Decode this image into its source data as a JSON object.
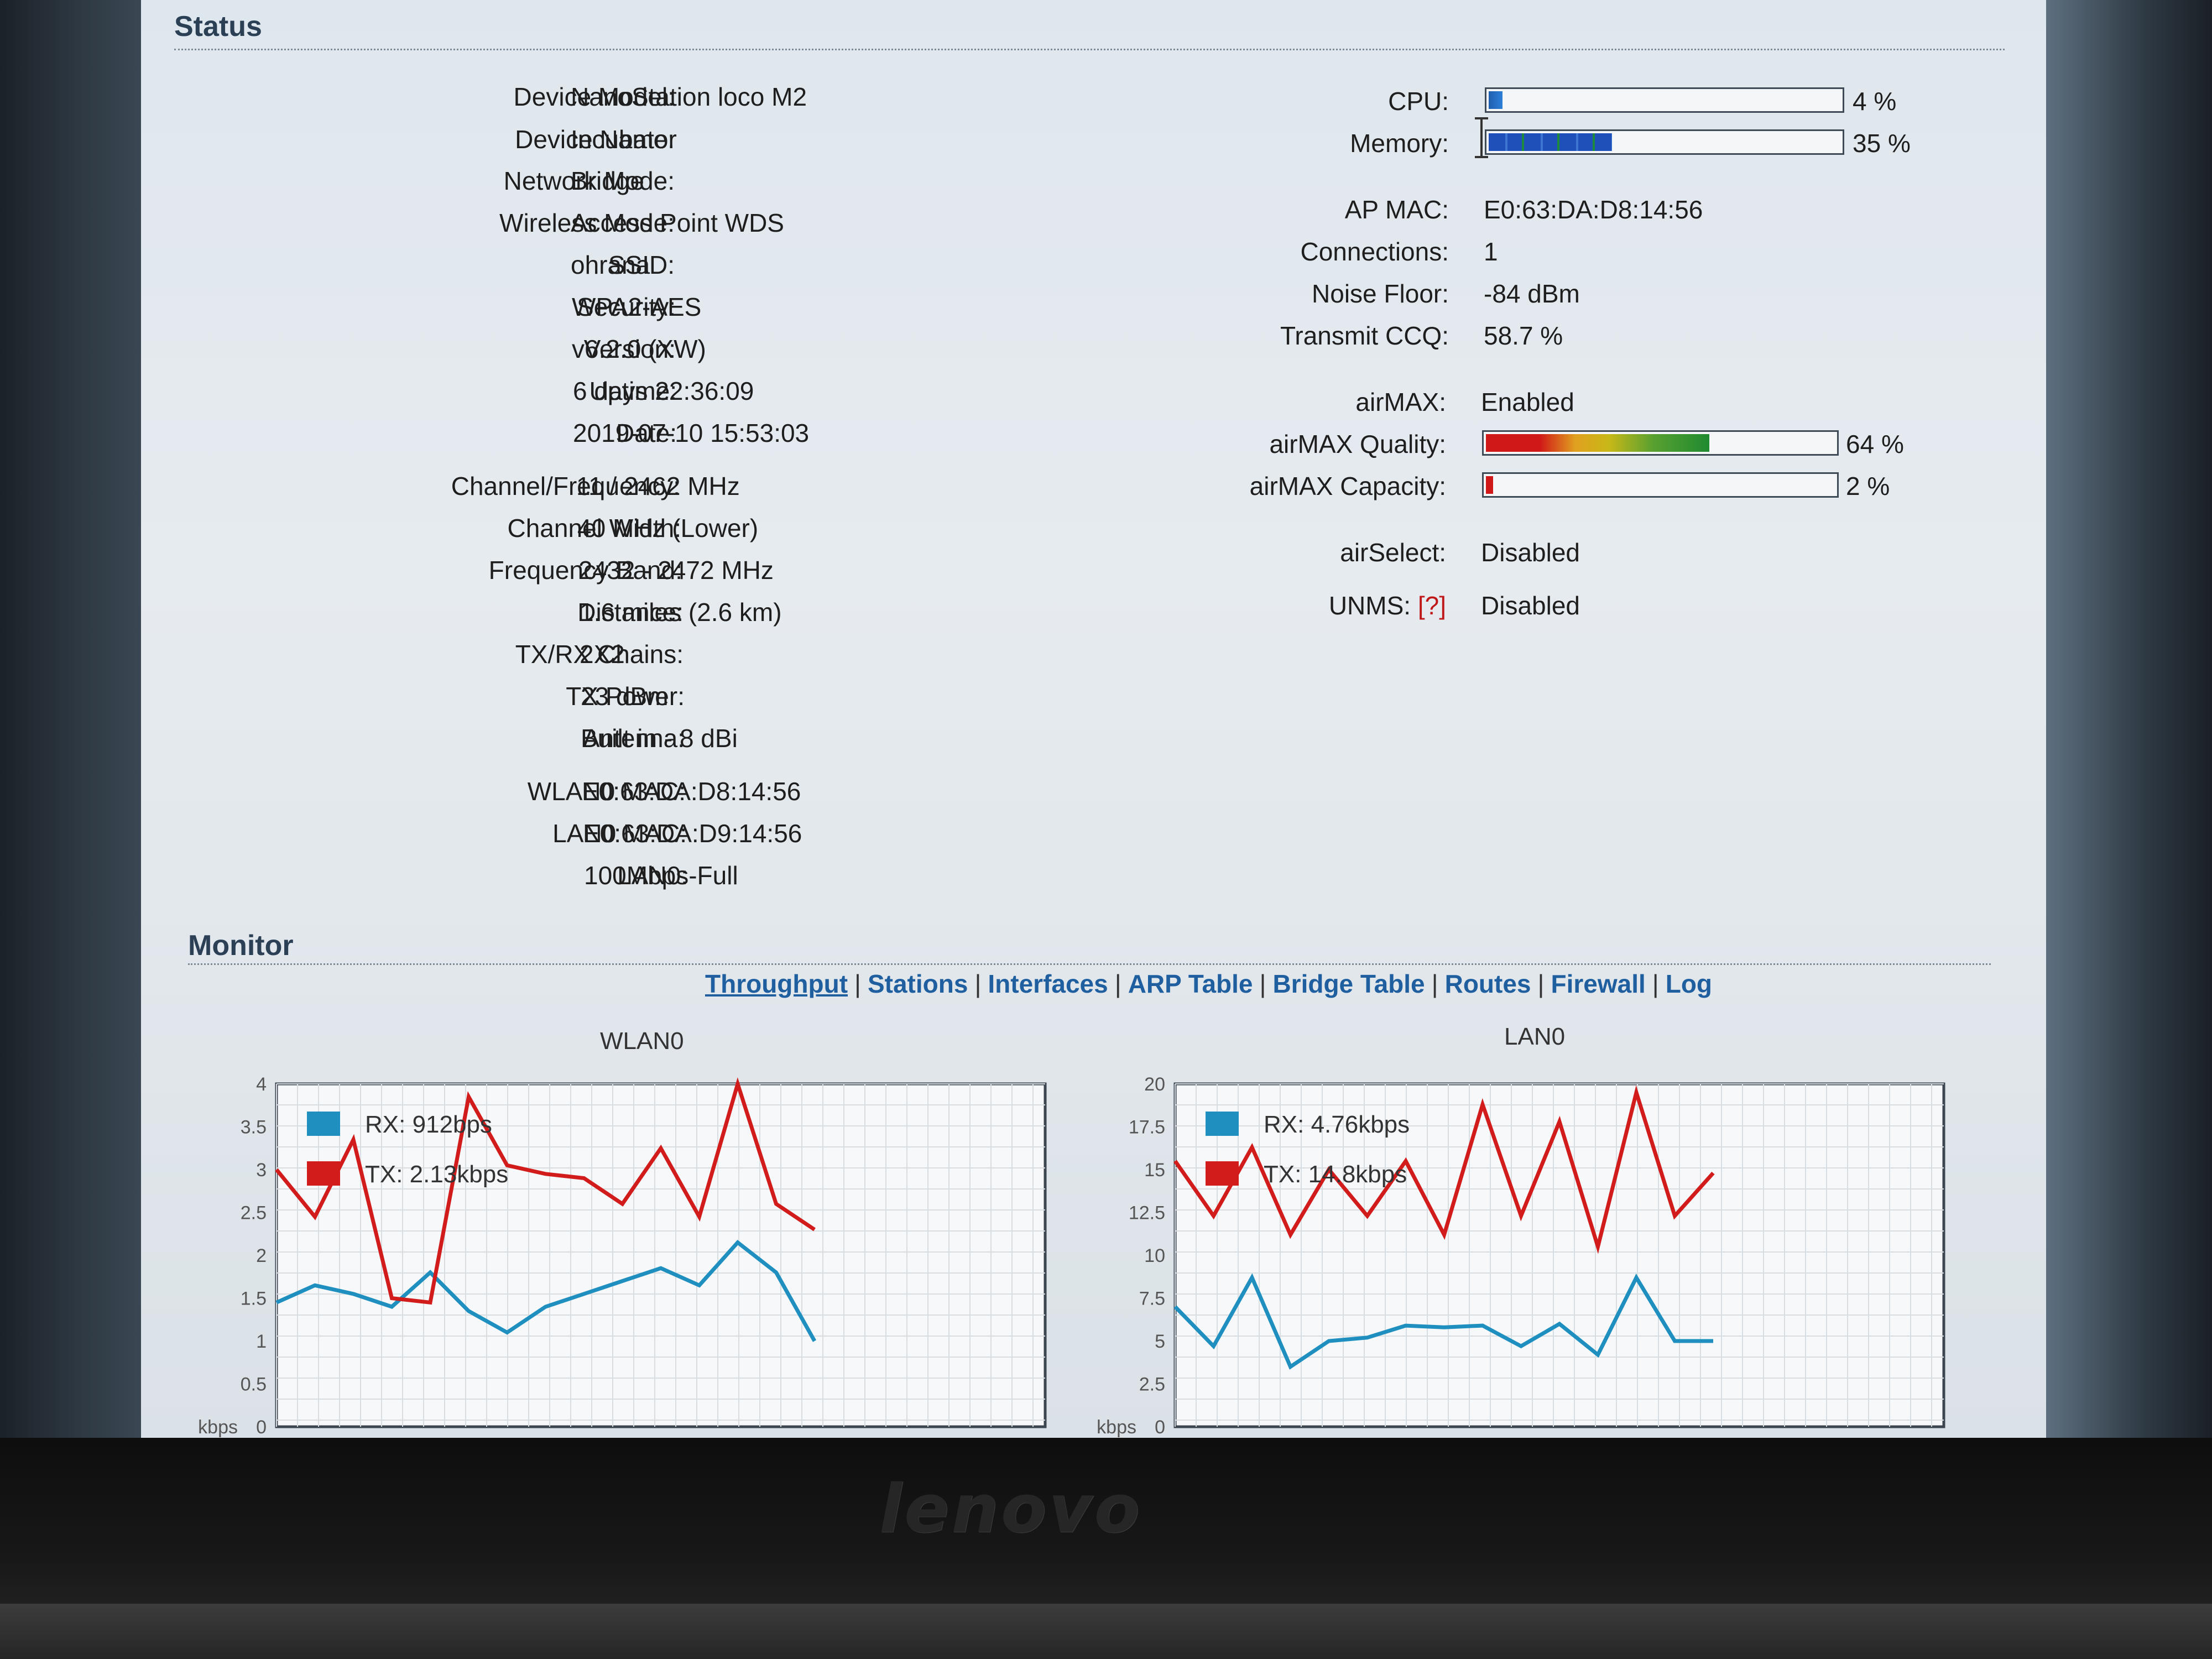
{
  "status": {
    "title": "Status",
    "left": [
      {
        "label": "Device Model:",
        "value": "NanoStation loco M2"
      },
      {
        "label": "Device Name:",
        "value": "Incubator"
      },
      {
        "label": "Network Mode:",
        "value": "Bridge"
      },
      {
        "label": "Wireless Mode:",
        "value": "Access Point WDS"
      },
      {
        "label": "SSID:",
        "value": "ohrana"
      },
      {
        "label": "Security:",
        "value": "WPA2-AES"
      },
      {
        "label": "Version:",
        "value": "v6.2.0 (XW)"
      },
      {
        "label": "Uptime:",
        "value": "6 days 22:36:09"
      },
      {
        "label": "Date:",
        "value": "2019-07-10 15:53:03"
      },
      {
        "label": "Channel/Frequency:",
        "value": "11 / 2462 MHz"
      },
      {
        "label": "Channel Width:",
        "value": "40 MHz (Lower)"
      },
      {
        "label": "Frequency Band:",
        "value": "2432 - 2472 MHz"
      },
      {
        "label": "Distance:",
        "value": "1.6 miles (2.6 km)"
      },
      {
        "label": "TX/RX Chains:",
        "value": "2X2"
      },
      {
        "label": "TX Power:",
        "value": "23 dBm"
      },
      {
        "label": "Antenna:",
        "value": "Built in - 8 dBi"
      },
      {
        "label": "WLAN0 MAC:",
        "value": "E0:63:DA:D8:14:56"
      },
      {
        "label": "LAN0 MAC:",
        "value": "E0:63:DA:D9:14:56"
      },
      {
        "label": "LAN0:",
        "value": "100Mbps-Full"
      }
    ],
    "right": {
      "cpu": {
        "label": "CPU:",
        "percent_text": "4 %",
        "level": 0.04
      },
      "memory": {
        "label": "Memory:",
        "percent_text": "35 %",
        "level": 0.35
      },
      "ap_mac": {
        "label": "AP MAC:",
        "value": "E0:63:DA:D8:14:56"
      },
      "connections": {
        "label": "Connections:",
        "value": "1"
      },
      "noise_floor": {
        "label": "Noise Floor:",
        "value": "-84 dBm"
      },
      "transmit_ccq": {
        "label": "Transmit CCQ:",
        "value": "58.7 %"
      },
      "airmax": {
        "label": "airMAX:",
        "value": "Enabled"
      },
      "airmax_quality": {
        "label": "airMAX Quality:",
        "percent_text": "64 %",
        "level": 0.64
      },
      "airmax_capacity": {
        "label": "airMAX Capacity:",
        "percent_text": "2 %",
        "level": 0.02
      },
      "airselect": {
        "label": "airSelect:",
        "value": "Disabled"
      },
      "unms": {
        "label": "UNMS:",
        "help": "[?]",
        "value": "Disabled"
      }
    }
  },
  "monitor": {
    "title": "Monitor",
    "tabs": [
      {
        "label": "Throughput",
        "active": true
      },
      {
        "label": "Stations"
      },
      {
        "label": "Interfaces"
      },
      {
        "label": "ARP Table"
      },
      {
        "label": "Bridge Table"
      },
      {
        "label": "Routes"
      },
      {
        "label": "Firewall"
      },
      {
        "label": "Log"
      }
    ],
    "separator": "|"
  },
  "chart_data": [
    {
      "type": "line",
      "title": "WLAN0",
      "ylabel": "kbps",
      "ylim": [
        0,
        4
      ],
      "yticks": [
        "0",
        "0.5",
        "1",
        "1.5",
        "2",
        "2.5",
        "3",
        "3.5",
        "4"
      ],
      "grid": true,
      "legend_position": "top-left",
      "series": [
        {
          "name": "RX: 912bps",
          "color": "#1f8fc0",
          "values": [
            1.45,
            1.65,
            1.55,
            1.4,
            1.8,
            1.35,
            1.1,
            1.4,
            1.55,
            1.7,
            1.85,
            1.65,
            2.15,
            1.8,
            1.0
          ]
        },
        {
          "name": "TX: 2.13kbps",
          "color": "#d21c1c",
          "values": [
            3.0,
            2.45,
            3.35,
            1.5,
            1.45,
            3.85,
            3.05,
            2.95,
            2.9,
            2.6,
            3.25,
            2.45,
            4.0,
            2.6,
            2.3
          ]
        }
      ]
    },
    {
      "type": "line",
      "title": "LAN0",
      "ylabel": "kbps",
      "ylim": [
        0,
        20
      ],
      "yticks": [
        "0",
        "2.5",
        "5",
        "7.5",
        "10",
        "12.5",
        "15",
        "17.5",
        "20"
      ],
      "grid": true,
      "legend_position": "top-left",
      "series": [
        {
          "name": "RX: 4.76kbps",
          "color": "#1f8fc0",
          "values": [
            7.0,
            4.7,
            8.7,
            3.5,
            5.0,
            5.2,
            5.9,
            5.8,
            5.9,
            4.7,
            6.0,
            4.2,
            8.7,
            5.0,
            5.0
          ]
        },
        {
          "name": "TX: 14.8kbps",
          "color": "#d21c1c",
          "values": [
            15.5,
            12.3,
            16.3,
            11.2,
            15.0,
            12.3,
            15.5,
            11.2,
            18.8,
            12.3,
            17.8,
            10.5,
            19.5,
            12.3,
            14.8
          ]
        }
      ]
    }
  ],
  "laptop": {
    "brand": "lenovo"
  }
}
